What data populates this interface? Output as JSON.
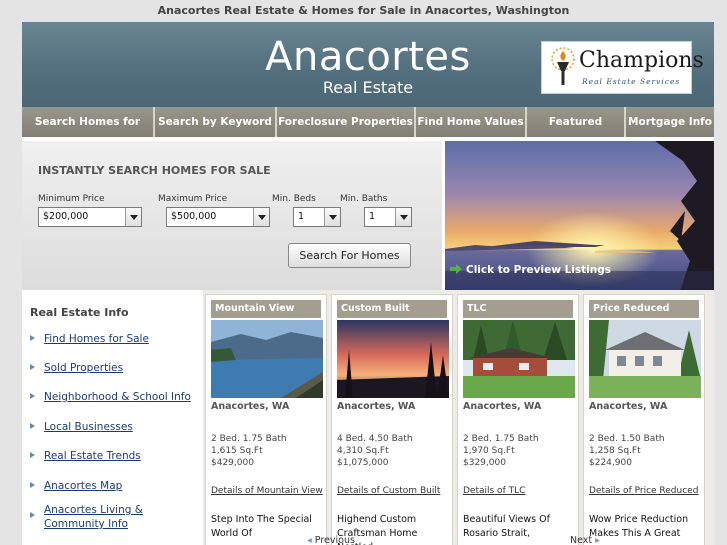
{
  "page": {
    "title": "Anacortes Real Estate & Homes for Sale in Anacortes, Washington"
  },
  "header": {
    "logo_main": "Anacortes",
    "logo_sub": "Real Estate",
    "brand_name": "Champions",
    "brand_sub": "Real Estate Services"
  },
  "nav": {
    "items": [
      {
        "label": "Search Homes for Sale"
      },
      {
        "label": "Search by Keyword"
      },
      {
        "label": "Foreclosure Properties"
      },
      {
        "label": "Find Home Values"
      },
      {
        "label": "Featured Homes"
      },
      {
        "label": "Mortgage Info"
      }
    ]
  },
  "search": {
    "heading": "INSTANTLY SEARCH HOMES FOR SALE",
    "min_price_label": "Minimum Price",
    "min_price_value": "$200,000",
    "max_price_label": "Maximum Price",
    "max_price_value": "$500,000",
    "beds_label": "Min. Beds",
    "beds_value": "1",
    "baths_label": "Min. Baths",
    "baths_value": "1",
    "button": "Search For Homes"
  },
  "preview": {
    "label": "Click to Preview Listings"
  },
  "sidebar": {
    "heading": "Real Estate Info",
    "links": [
      {
        "label": "Find Homes for Sale"
      },
      {
        "label": "Sold Properties"
      },
      {
        "label": "Neighborhood & School Info"
      },
      {
        "label": "Local Businesses"
      },
      {
        "label": "Real Estate Trends"
      },
      {
        "label": "Anacortes Map"
      },
      {
        "label": "Anacortes Living & Community Info"
      }
    ]
  },
  "listings": [
    {
      "tag": "Mountain View",
      "city": "Anacortes, WA",
      "beds_baths": "2 Bed. 1.75 Bath",
      "sqft": "1,615 Sq.Ft",
      "price": "$429,000",
      "details": "Details of Mountain View",
      "desc": "Step Into The Special World Of"
    },
    {
      "tag": "Custom Built",
      "city": "Anacortes, WA",
      "beds_baths": "4 Bed. 4.50 Bath",
      "sqft": "4,310 Sq.Ft",
      "price": "$1,075,000",
      "details": "Details of Custom Built",
      "desc": "Highend Custom Craftsman Home Nestled"
    },
    {
      "tag": "TLC",
      "city": "Anacortes, WA",
      "beds_baths": "2 Bed. 1.75 Bath",
      "sqft": "1,970 Sq.Ft",
      "price": "$329,000",
      "details": "Details of TLC",
      "desc": "Beautiful Views Of Rosario Strait,"
    },
    {
      "tag": "Price Reduced",
      "city": "Anacortes, WA",
      "beds_baths": "2 Bed. 1.50 Bath",
      "sqft": "1,258 Sq.Ft",
      "price": "$224,900",
      "details": "Details of Price Reduced",
      "desc": "Wow Price Reduction Makes This A Great"
    }
  ],
  "pager": {
    "previous": "Previous",
    "next": "Next"
  },
  "colors": {
    "header_bg": "#54707e",
    "nav_bg": "#8b877d",
    "card_header": "#a39e8f",
    "link": "#1b3b78"
  }
}
